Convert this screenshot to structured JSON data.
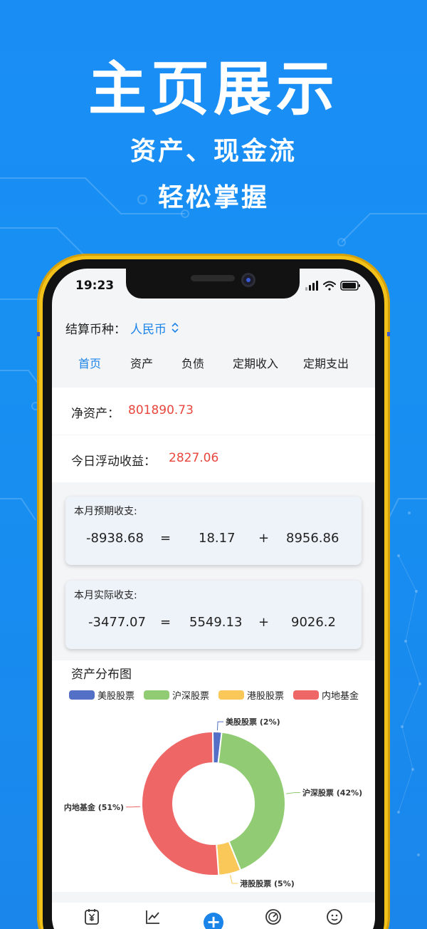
{
  "promo": {
    "headline": "主页展示",
    "line1": "资产、现金流",
    "line2": "轻松掌握"
  },
  "status_bar": {
    "time": "19:23"
  },
  "currency": {
    "label": "结算币种：",
    "value": "人民币"
  },
  "tabs": [
    {
      "label": "首页",
      "active": true
    },
    {
      "label": "资产",
      "active": false
    },
    {
      "label": "负债",
      "active": false
    },
    {
      "label": "定期收入",
      "active": false
    },
    {
      "label": "定期支出",
      "active": false
    }
  ],
  "net_assets": {
    "label": "净资产：",
    "value": "801890.73"
  },
  "daily_gain": {
    "label": "今日浮动收益：",
    "value": "2827.06"
  },
  "expected": {
    "title": "本月预期收支:",
    "result": "-8938.68",
    "eq": "=",
    "a": "18.17",
    "plus": "+",
    "b": "8956.86"
  },
  "actual": {
    "title": "本月实际收支:",
    "result": "-3477.07",
    "eq": "=",
    "a": "5549.13",
    "plus": "+",
    "b": "9026.2"
  },
  "chart": {
    "title": "资产分布图",
    "colors": [
      "#5470c6",
      "#91cc75",
      "#fac858",
      "#ee6666"
    ]
  },
  "chart_data": {
    "type": "pie",
    "donut": true,
    "legend_placement": "top",
    "categories": [
      "美股股票",
      "沪深股票",
      "港股股票",
      "内地基金"
    ],
    "values": [
      2,
      42,
      5,
      51
    ],
    "labels": [
      "美股股票 (2%)",
      "沪深股票 (42%)",
      "港股股票 (5%)",
      "内地基金 (51%)"
    ]
  },
  "bottom_nav": {
    "items": [
      "yen-ledger-icon",
      "trend-chart-icon",
      "add-icon",
      "gauge-icon",
      "profile-icon"
    ],
    "add_symbol": "+"
  }
}
